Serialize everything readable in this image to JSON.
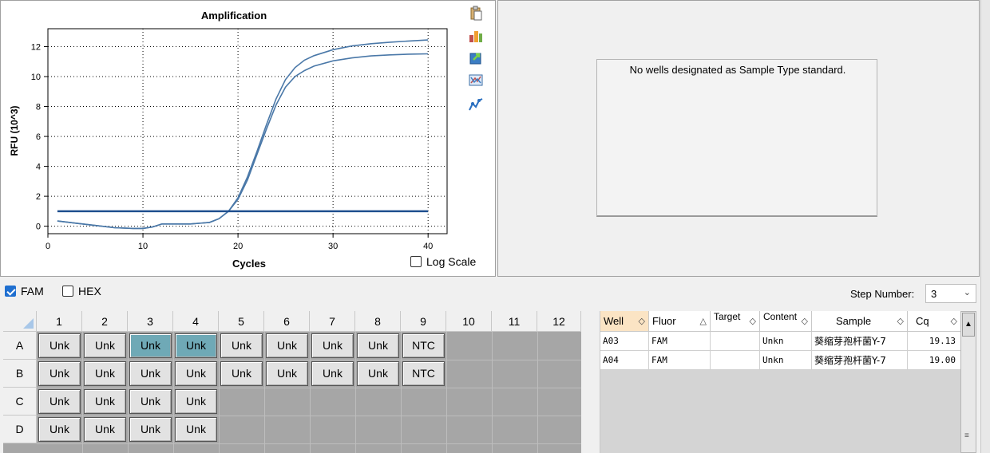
{
  "chart": {
    "title": "Amplification",
    "xlabel": "Cycles",
    "ylabel": "RFU (10^3)",
    "log_scale_label": "Log Scale",
    "log_scale_checked": false
  },
  "chart_data": {
    "type": "line",
    "title": "Amplification",
    "xlabel": "Cycles",
    "ylabel": "RFU (10^3)",
    "xlim": [
      0,
      42
    ],
    "ylim": [
      -0.5,
      13.2
    ],
    "x_ticks": [
      0,
      10,
      20,
      30,
      40
    ],
    "y_ticks": [
      0,
      2,
      4,
      6,
      8,
      10,
      12
    ],
    "grid": true,
    "threshold": 1.0,
    "series": [
      {
        "color": "#4a78a8",
        "x": [
          1,
          3,
          5,
          7,
          9,
          10,
          11,
          12,
          13,
          15,
          17,
          18,
          19,
          20,
          21,
          22,
          23,
          24,
          25,
          26,
          27,
          28,
          30,
          32,
          34,
          36,
          38,
          40
        ],
        "y": [
          0.35,
          0.2,
          0.05,
          -0.1,
          -0.15,
          -0.15,
          -0.05,
          0.15,
          0.15,
          0.15,
          0.25,
          0.5,
          1.0,
          1.9,
          3.3,
          5.0,
          6.8,
          8.5,
          9.8,
          10.6,
          11.1,
          11.4,
          11.8,
          12.05,
          12.2,
          12.3,
          12.38,
          12.45
        ]
      },
      {
        "color": "#4a78a8",
        "x": [
          1,
          3,
          5,
          7,
          9,
          10,
          11,
          12,
          13,
          15,
          17,
          18,
          19,
          20,
          21,
          22,
          23,
          24,
          25,
          26,
          27,
          28,
          30,
          32,
          34,
          36,
          38,
          40
        ],
        "y": [
          0.35,
          0.2,
          0.05,
          -0.1,
          -0.15,
          -0.15,
          -0.05,
          0.15,
          0.15,
          0.15,
          0.25,
          0.5,
          1.0,
          1.8,
          3.1,
          4.8,
          6.5,
          8.1,
          9.3,
          10.0,
          10.4,
          10.7,
          11.05,
          11.25,
          11.38,
          11.45,
          11.5,
          11.52
        ]
      }
    ]
  },
  "standard": {
    "message": "No wells designated as Sample Type standard."
  },
  "fluors": [
    {
      "label": "FAM",
      "checked": true
    },
    {
      "label": "HEX",
      "checked": false
    }
  ],
  "step": {
    "label": "Step Number:",
    "value": "3"
  },
  "plate": {
    "columns": [
      "1",
      "2",
      "3",
      "4",
      "5",
      "6",
      "7",
      "8",
      "9",
      "10",
      "11",
      "12"
    ],
    "rows": [
      "A",
      "B",
      "C",
      "D"
    ],
    "wells": [
      [
        "Unk",
        "Unk",
        "Unk",
        "Unk",
        "Unk",
        "Unk",
        "Unk",
        "Unk",
        "NTC",
        "",
        "",
        ""
      ],
      [
        "Unk",
        "Unk",
        "Unk",
        "Unk",
        "Unk",
        "Unk",
        "Unk",
        "Unk",
        "NTC",
        "",
        "",
        ""
      ],
      [
        "Unk",
        "Unk",
        "Unk",
        "Unk",
        "",
        "",
        "",
        "",
        "",
        "",
        "",
        ""
      ],
      [
        "Unk",
        "Unk",
        "Unk",
        "Unk",
        "",
        "",
        "",
        "",
        "",
        "",
        "",
        ""
      ]
    ],
    "selected": [
      "A3",
      "A4"
    ]
  },
  "results": {
    "headers": [
      "Well",
      "Fluor",
      "Target",
      "Content",
      "Sample",
      "Cq"
    ],
    "rows": [
      [
        "A03",
        "FAM",
        "",
        "Unkn",
        "葵缩芽孢杆菌Y-7",
        "19.13"
      ],
      [
        "A04",
        "FAM",
        "",
        "Unkn",
        "葵缩芽孢杆菌Y-7",
        "19.00"
      ]
    ]
  }
}
